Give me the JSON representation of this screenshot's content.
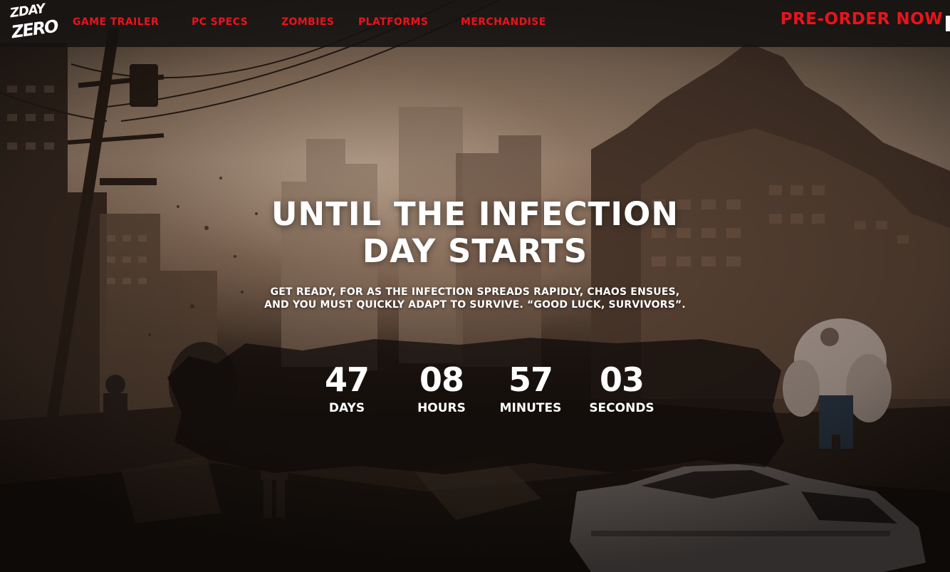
{
  "brand": {
    "logo_line1": "ZDAY",
    "logo_line2": "ZERO"
  },
  "nav": {
    "links": [
      {
        "label": "GAME TRAILER"
      },
      {
        "label": "PC SPECS"
      },
      {
        "label": "ZOMBIES"
      },
      {
        "label": "PLATFORMS"
      },
      {
        "label": "MERCHANDISE"
      }
    ],
    "cta_label": "PRE-ORDER NOW"
  },
  "hero": {
    "title_line1": "UNTIL THE INFECTION",
    "title_line2": "DAY STARTS",
    "subtitle_line1": "GET READY, FOR AS THE INFECTION SPREADS RAPIDLY, CHAOS ENSUES,",
    "subtitle_line2": "AND YOU MUST QUICKLY ADAPT TO SURVIVE. “GOOD LUCK, SURVIVORS”."
  },
  "countdown": [
    {
      "value": "47",
      "label": "DAYS"
    },
    {
      "value": "08",
      "label": "HOURS"
    },
    {
      "value": "57",
      "label": "MINUTES"
    },
    {
      "value": "03",
      "label": "SECONDS"
    }
  ],
  "colors": {
    "accent": "#e8141c",
    "text": "#ffffff",
    "nav_bg": "#141211"
  }
}
